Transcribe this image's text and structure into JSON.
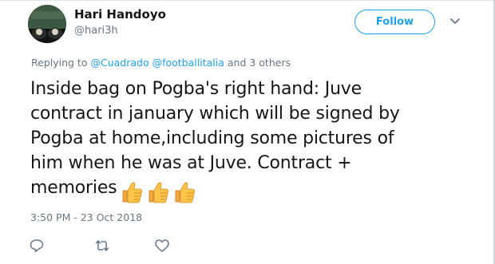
{
  "user": {
    "display_name": "Hari Handoyo",
    "handle": "@hari3h"
  },
  "header": {
    "follow_label": "Follow",
    "menu_icon": "chevron-down-icon"
  },
  "reply": {
    "prefix": "Replying to",
    "mentions": [
      "@Cuadrado",
      "@footballitalia"
    ],
    "suffix": "and 3 others"
  },
  "tweet": {
    "lines": [
      "Inside bag on Pogba's right hand: Juve",
      "contract in january which will be signed by",
      "Pogba at home,including some pictures of",
      "him when he was at Juve. Contract +",
      "memories"
    ],
    "emoji_icons": [
      "thumbs-up-icon",
      "thumbs-up-icon",
      "thumbs-up-icon"
    ],
    "timestamp": "3:50 PM - 23 Oct 2018"
  },
  "actions": [
    "reply-icon",
    "retweet-icon",
    "like-icon"
  ],
  "colors": {
    "accent": "#1da1f2",
    "secondary_text": "#657786",
    "primary_text": "#14171a"
  }
}
